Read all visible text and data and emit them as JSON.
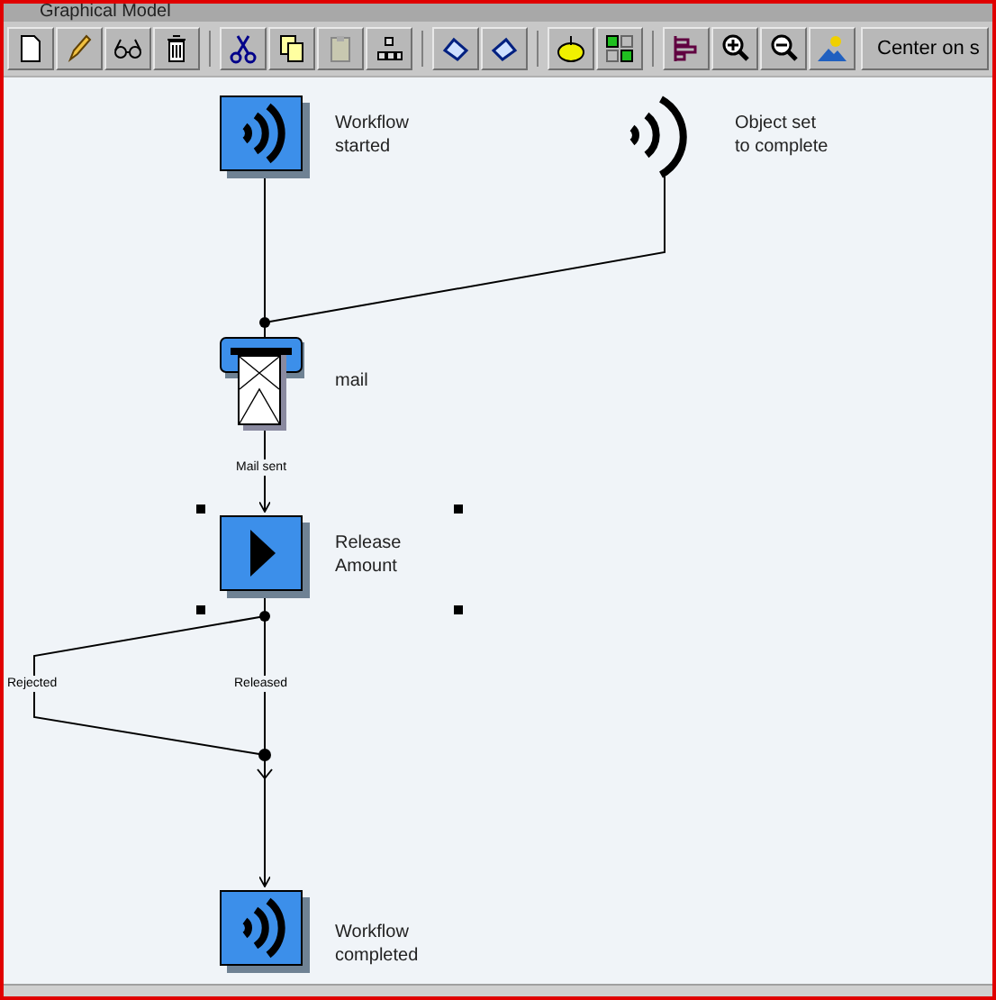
{
  "window": {
    "title": "Graphical Model"
  },
  "toolbar": {
    "center_button": "Center on s"
  },
  "nodes": [
    {
      "kind": "event",
      "label": [
        "Workflow",
        "started"
      ],
      "selected": false
    },
    {
      "kind": "trigger",
      "label": [
        "Object set",
        "to complete"
      ],
      "selected": false
    },
    {
      "kind": "mail",
      "label": [
        "mail"
      ],
      "selected": false
    },
    {
      "kind": "activity",
      "label": [
        "Release",
        "Amount"
      ],
      "selected": true
    },
    {
      "kind": "event",
      "label": [
        "Workflow",
        "completed"
      ],
      "selected": false
    }
  ],
  "edge_labels": [
    "Mail sent",
    "Rejected",
    "Released"
  ]
}
